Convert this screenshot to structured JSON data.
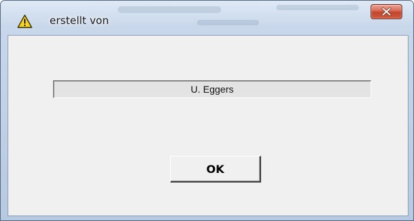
{
  "window": {
    "title": "erstellt von",
    "icon": "warning-icon",
    "close_icon": "close-icon",
    "close_button_color": "#c2452c"
  },
  "dialog": {
    "author_value": "U. Eggers",
    "ok_label": "OK"
  }
}
